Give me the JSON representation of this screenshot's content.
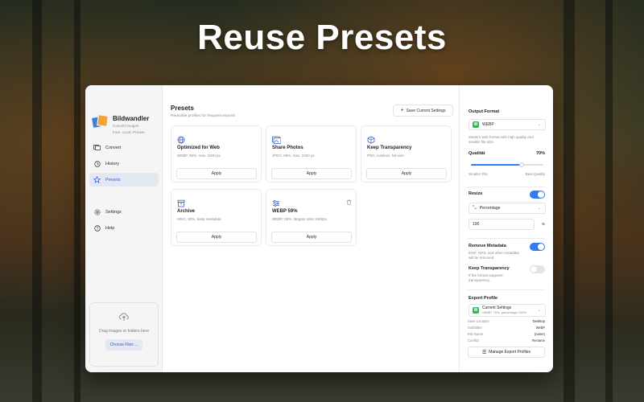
{
  "headline": "Reuse Presets",
  "app": {
    "name": "Bildwandler",
    "tagline_1": "Convert images.",
    "tagline_2": "Fast. Local. Private."
  },
  "sidebar": {
    "items": [
      {
        "label": "Convert",
        "icon": "convert-icon"
      },
      {
        "label": "History",
        "icon": "history-icon"
      },
      {
        "label": "Presets",
        "icon": "star-icon",
        "active": true
      },
      {
        "label": "Settings",
        "icon": "gear-icon"
      },
      {
        "label": "Help",
        "icon": "help-icon"
      }
    ],
    "dropzone": {
      "text": "Drag images or folders here",
      "button": "Choose Files ..."
    }
  },
  "main": {
    "title": "Presets",
    "subtitle": "Reusable profiles for frequent exports",
    "save_button": "Save Current Settings",
    "cards": [
      {
        "title": "Optimized for Web",
        "desc": "WEBP, 80%, max. 1600 px",
        "apply": "Apply",
        "icon": "globe-icon"
      },
      {
        "title": "Share Photos",
        "desc": "JPEG, 86%, max. 2400 px",
        "apply": "Apply",
        "icon": "share-photos-icon"
      },
      {
        "title": "Keep Transparency",
        "desc": "PNG, lossless, full size",
        "apply": "Apply",
        "icon": "layers-icon"
      },
      {
        "title": "Archive",
        "desc": "HEIC, 90%, keep metadata",
        "apply": "Apply",
        "icon": "archive-icon"
      },
      {
        "title": "WEBP 59%",
        "desc": "WEBP, 59%, längste seite 2400px",
        "apply": "Apply",
        "icon": "sliders-icon"
      }
    ]
  },
  "right": {
    "output_format": {
      "label": "Output Format",
      "value": "WEBP",
      "badge": "W",
      "desc": "Modern web format with high quality and smaller file size."
    },
    "quality": {
      "label": "Qualität",
      "value_text": "70%",
      "value": 0.7,
      "min_label": "Smaller File",
      "max_label": "Best Quality"
    },
    "resize": {
      "label": "Resize",
      "on": true,
      "mode": "Percentage",
      "amount": "100",
      "unit": "%"
    },
    "remove_metadata": {
      "label": "Remove Metadata",
      "on": true,
      "desc": "EXIF, GPS, and other metadata will be removed."
    },
    "keep_transparency": {
      "label": "Keep Transparency",
      "on": false,
      "desc": "If the format supports transparency."
    },
    "export_profile": {
      "label": "Export Profile",
      "current": "Current Settings",
      "current_desc": "WEBP, 70%, percentage 100%",
      "rows": [
        {
          "k": "Save Location",
          "v": "Desktop"
        },
        {
          "k": "Subfolder",
          "v": "WebP"
        },
        {
          "k": "File Name",
          "v": "{name}"
        },
        {
          "k": "Conflict",
          "v": "Rename"
        }
      ],
      "manage": "Manage Export Profiles"
    }
  },
  "colors": {
    "accent": "#2f7cf6",
    "format_badge": "#34b758",
    "active_nav_bg": "#e3e7f1"
  }
}
